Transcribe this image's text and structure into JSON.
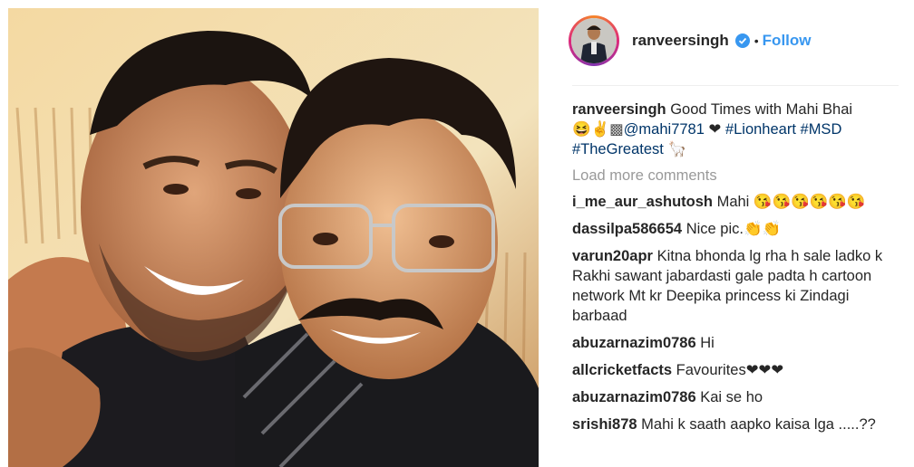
{
  "post": {
    "image_alt": "Selfie of two smiling men",
    "author": {
      "username": "ranveersingh",
      "verified": true,
      "separator": "•",
      "follow_label": "Follow"
    },
    "caption": {
      "username": "ranveersingh",
      "text": "Good Times with Mahi Bhai",
      "emojis": "😆✌️▩",
      "mention": "@mahi7781",
      "heart": "❤",
      "hashtags": [
        "#Lionheart",
        "#MSD",
        "#TheGreatest"
      ],
      "trailing_emoji": "🦙"
    },
    "load_more_label": "Load more comments",
    "comments": [
      {
        "username": "i_me_aur_ashutosh",
        "text": "Mahi 😘😘😘😘😘😘"
      },
      {
        "username": "dassilpa586654",
        "text": "Nice pic.👏👏"
      },
      {
        "username": "varun20apr",
        "text": "Kitna bhonda lg rha h sale ladko k Rakhi sawant jabardasti gale padta h cartoon network Mt kr Deepika princess ki Zindagi barbaad"
      },
      {
        "username": "abuzarnazim0786",
        "text": "Hi"
      },
      {
        "username": "allcricketfacts",
        "text": "Favourites❤❤❤"
      },
      {
        "username": "abuzarnazim0786",
        "text": "Kai se ho"
      },
      {
        "username": "srishi878",
        "text": "Mahi k saath aapko kaisa lga .....??"
      }
    ]
  },
  "colors": {
    "link": "#003569",
    "follow": "#3897f0",
    "muted": "#999999",
    "text": "#262626"
  }
}
